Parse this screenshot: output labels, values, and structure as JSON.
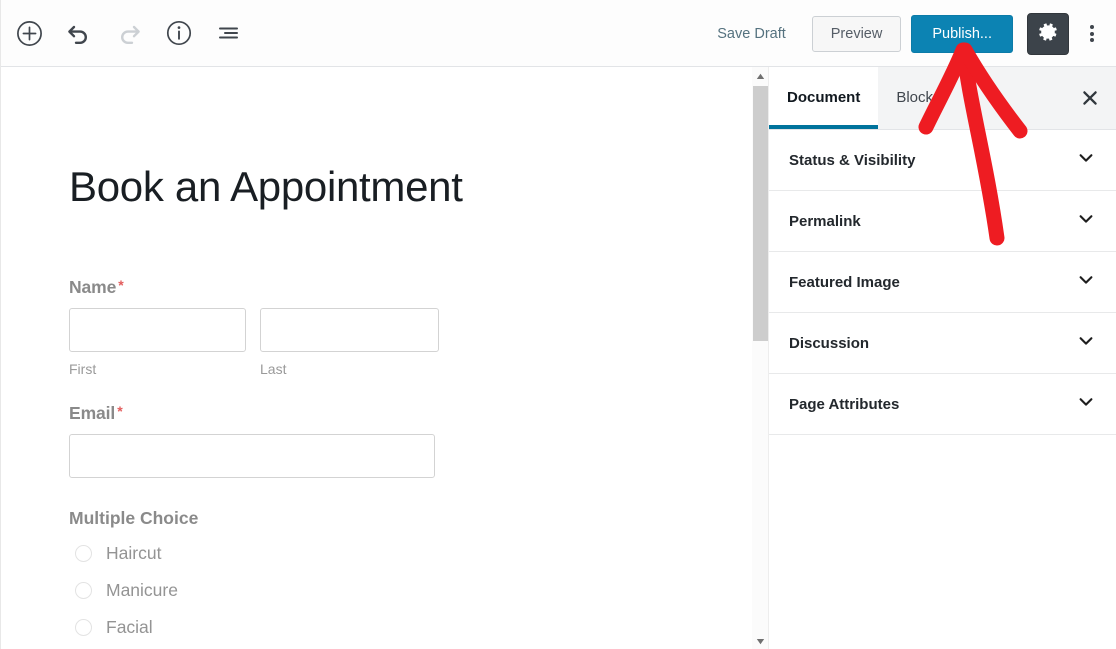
{
  "toolbar": {
    "icons": [
      {
        "name": "add-block-icon",
        "label": "Add block"
      },
      {
        "name": "undo-icon",
        "label": "Undo"
      },
      {
        "name": "redo-icon",
        "label": "Redo"
      },
      {
        "name": "info-icon",
        "label": "Content structure"
      },
      {
        "name": "list-view-icon",
        "label": "Block navigation"
      }
    ],
    "save_draft_label": "Save Draft",
    "preview_label": "Preview",
    "publish_label": "Publish...",
    "settings_icon": "gear-icon",
    "more_menu_icon": "kebab-menu-icon",
    "publish_button_color": "#0c83b3",
    "settings_button_color": "#3c434a",
    "save_draft_color": "#55727f"
  },
  "editor": {
    "post_title": "Book an Appointment",
    "form": {
      "name_field": {
        "label": "Name",
        "required_marker": "*",
        "first": {
          "value": "",
          "placeholder": "",
          "sub_label": "First"
        },
        "last": {
          "value": "",
          "placeholder": "",
          "sub_label": "Last"
        }
      },
      "email_field": {
        "label": "Email",
        "required_marker": "*",
        "value": "",
        "placeholder": ""
      },
      "multiple_choice": {
        "label": "Multiple Choice",
        "options": [
          {
            "label": "Haircut",
            "selected": false
          },
          {
            "label": "Manicure",
            "selected": false
          },
          {
            "label": "Facial",
            "selected": false
          }
        ]
      },
      "required_color": "#e25c5c",
      "label_color": "#8a8a8a"
    }
  },
  "sidebar": {
    "tabs": [
      {
        "label": "Document",
        "active": true
      },
      {
        "label": "Block",
        "active": false
      }
    ],
    "close_icon": "close-icon",
    "active_tab_accent": "#00739c",
    "panels": [
      {
        "label": "Status & Visibility",
        "expanded": false,
        "icon": "chevron-down-icon"
      },
      {
        "label": "Permalink",
        "expanded": false,
        "icon": "chevron-down-icon"
      },
      {
        "label": "Featured Image",
        "expanded": false,
        "icon": "chevron-down-icon"
      },
      {
        "label": "Discussion",
        "expanded": false,
        "icon": "chevron-down-icon"
      },
      {
        "label": "Page Attributes",
        "expanded": false,
        "icon": "chevron-down-icon"
      }
    ],
    "scrollbar": {
      "up_arrow_icon": "scroll-up-arrow-icon",
      "down_arrow_icon": "scroll-down-arrow-icon"
    }
  },
  "annotation": {
    "type": "arrow",
    "color": "#ee1c22",
    "points_to": "Publish..."
  }
}
